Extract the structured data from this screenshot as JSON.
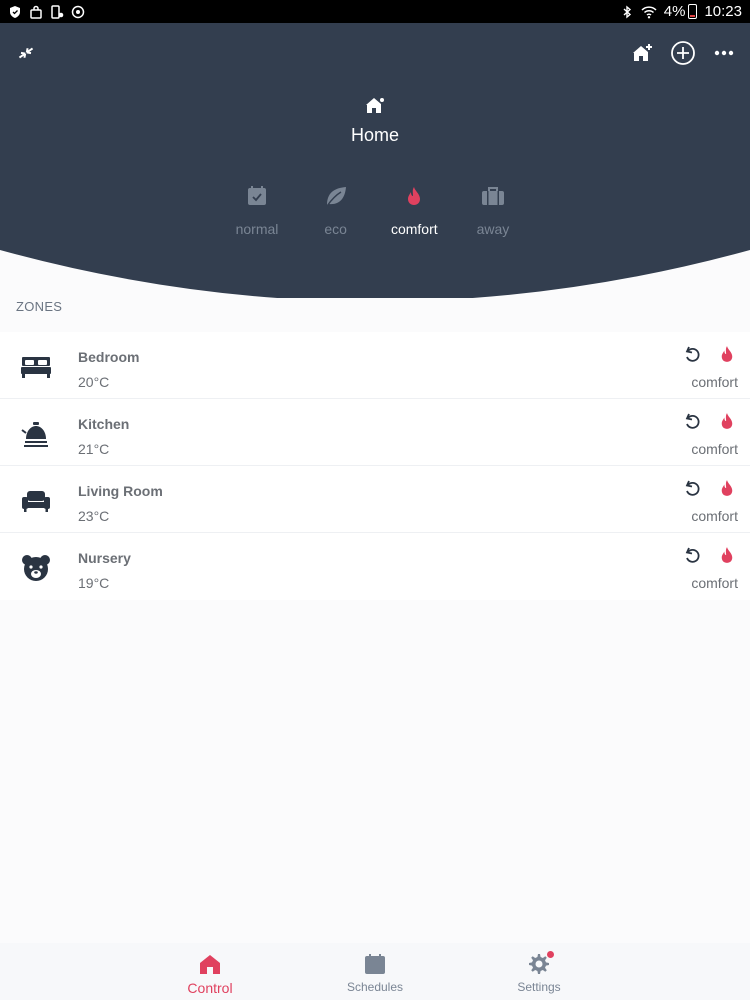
{
  "status_bar": {
    "battery": "4%",
    "time": "10:23"
  },
  "header": {
    "home_title": "Home",
    "modes": [
      {
        "label": "normal",
        "icon": "calendar-check-icon",
        "active": false
      },
      {
        "label": "eco",
        "icon": "leaf-icon",
        "active": false
      },
      {
        "label": "comfort",
        "icon": "flame-icon",
        "active": true
      },
      {
        "label": "away",
        "icon": "suitcase-icon",
        "active": false
      }
    ]
  },
  "zones": {
    "section_label": "ZONES",
    "items": [
      {
        "name": "Bedroom",
        "temp": "20°C",
        "mode": "comfort",
        "icon": "bed-icon"
      },
      {
        "name": "Kitchen",
        "temp": "21°C",
        "mode": "comfort",
        "icon": "kettle-icon"
      },
      {
        "name": "Living Room",
        "temp": "23°C",
        "mode": "comfort",
        "icon": "armchair-icon"
      },
      {
        "name": "Nursery",
        "temp": "19°C",
        "mode": "comfort",
        "icon": "teddy-bear-icon"
      }
    ]
  },
  "nav": {
    "items": [
      {
        "label": "Control",
        "icon": "home-icon",
        "active": true
      },
      {
        "label": "Schedules",
        "icon": "calendar-icon",
        "active": false
      },
      {
        "label": "Settings",
        "icon": "gear-icon",
        "active": false
      }
    ]
  },
  "colors": {
    "header_bg": "#333e4f",
    "accent": "#e0415f",
    "inactive": "#7a8594"
  }
}
